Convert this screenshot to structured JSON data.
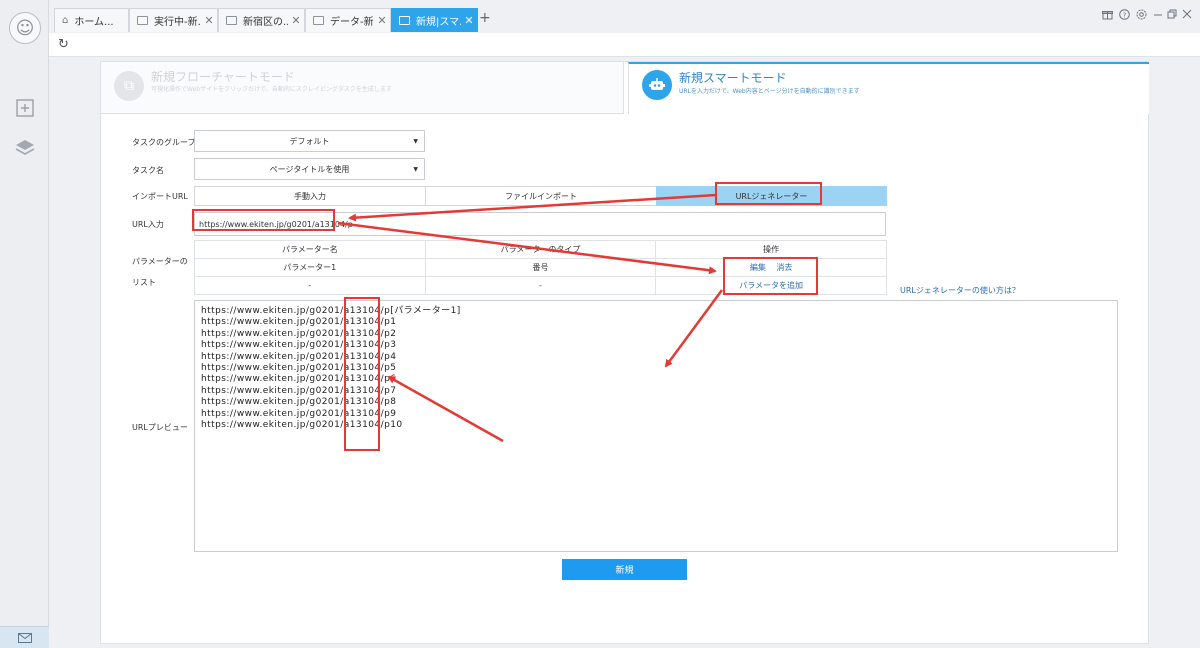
{
  "tabs": [
    {
      "label": "ホーム...",
      "close": ""
    },
    {
      "label": "実行中-新...",
      "close": "✕"
    },
    {
      "label": "新宿区の...",
      "close": "✕"
    },
    {
      "label": "データ-新...",
      "close": "✕"
    },
    {
      "label": "新規|スマ...",
      "close": "✕"
    }
  ],
  "tab_add": "+",
  "modes": {
    "flow": {
      "title": "新規フローチャートモード",
      "desc": "可視化操作でWebサイトをクリックだけで、自動的にスクレイピングタスクを生成します"
    },
    "smart": {
      "title": "新規スマートモード",
      "desc": "URLを入力だけで、Web内容とページ分けを自動的に識別できます"
    }
  },
  "form": {
    "group_label": "タスクのグループ",
    "group_value": "デフォルト",
    "name_label": "タスク名",
    "name_value": "ページタイトルを使用",
    "import_label": "インポートURL",
    "import_options": [
      "手動入力",
      "ファイルインポート",
      "URLジェネレーター"
    ],
    "url_label": "URL入力",
    "url_value": "https://www.ekiten.jp/g0201/a13104/p",
    "param_list_label": "パラメーターのリスト",
    "param_headers": [
      "パラメーター名",
      "パラメーターのタイプ",
      "操作"
    ],
    "param_row": {
      "name": "パラメーター1",
      "type": "番号",
      "edit": "編集",
      "delete": "消去"
    },
    "param_row2": {
      "name": "-",
      "type": "-",
      "add": "パラメータを追加"
    },
    "help_link": "URLジェネレーターの使い方は？",
    "preview_label": "URLプレビュー",
    "preview_lines": [
      "https://www.ekiten.jp/g0201/a13104/p[パラメーター1]",
      "https://www.ekiten.jp/g0201/a13104/p1",
      "https://www.ekiten.jp/g0201/a13104/p2",
      "https://www.ekiten.jp/g0201/a13104/p3",
      "https://www.ekiten.jp/g0201/a13104/p4",
      "https://www.ekiten.jp/g0201/a13104/p5",
      "https://www.ekiten.jp/g0201/a13104/p6",
      "https://www.ekiten.jp/g0201/a13104/p7",
      "https://www.ekiten.jp/g0201/a13104/p8",
      "https://www.ekiten.jp/g0201/a13104/p9",
      "https://www.ekiten.jp/g0201/a13104/p10"
    ],
    "submit_label": "新規"
  },
  "colors": {
    "accent": "#2ea4ea",
    "selected_segment": "#9dd3f2",
    "annotation": "#e53935",
    "link": "#2b6cb0"
  }
}
